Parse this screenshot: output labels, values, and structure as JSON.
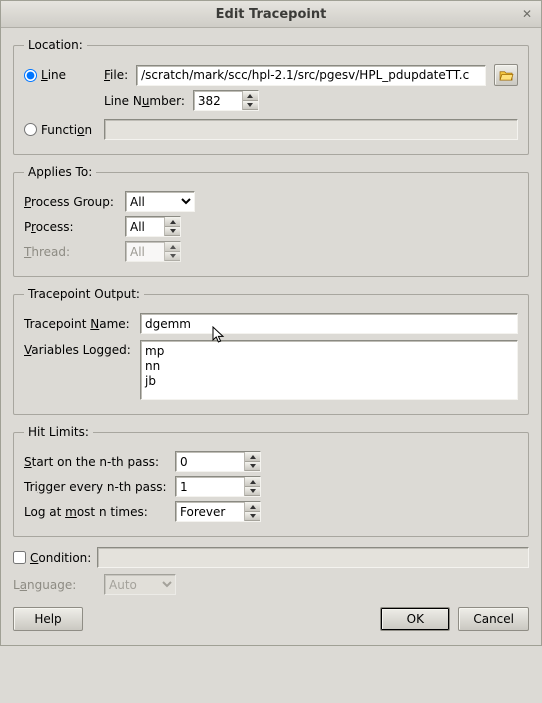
{
  "title": "Edit Tracepoint",
  "location": {
    "legend": "Location:",
    "line_radio": "Line",
    "function_radio": "Function",
    "file_label": "File:",
    "file_value": "/scratch/mark/scc/hpl-2.1/src/pgesv/HPL_pdupdateTT.c",
    "line_number_label": "Line Number:",
    "line_number_value": "382",
    "function_value": ""
  },
  "applies": {
    "legend": "Applies To:",
    "process_group_label": "Process Group:",
    "process_group_value": "All",
    "process_label": "Process:",
    "process_value": "All",
    "thread_label": "Thread:",
    "thread_value": "All"
  },
  "tp_output": {
    "legend": "Tracepoint Output:",
    "name_label": "Tracepoint Name:",
    "name_value": "dgemm",
    "vars_label": "Variables Logged:",
    "vars_value": "mp\nnn\njb"
  },
  "hits": {
    "legend": "Hit Limits:",
    "start_label": "Start on the n-th pass:",
    "start_value": "0",
    "every_label": "Trigger every n-th pass:",
    "every_value": "1",
    "max_label": "Log at most n times:",
    "max_value": "Forever"
  },
  "condition": {
    "label": "Condition:",
    "value": ""
  },
  "language": {
    "label": "Language:",
    "value": "Auto"
  },
  "buttons": {
    "help": "Help",
    "ok": "OK",
    "cancel": "Cancel"
  }
}
